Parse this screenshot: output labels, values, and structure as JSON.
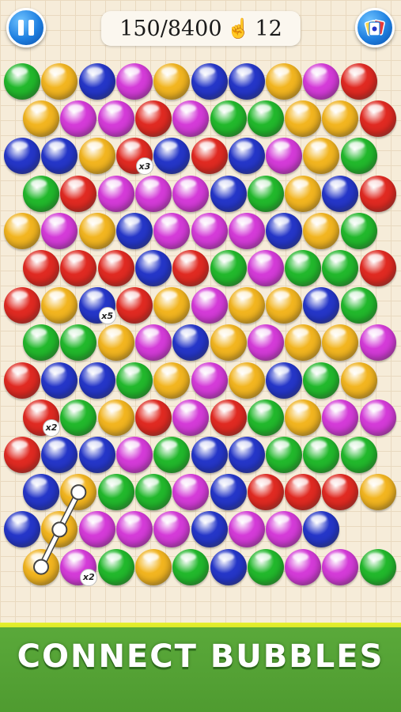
{
  "hud": {
    "score": "150/8400",
    "moves": "12",
    "pause_icon": "pause-icon",
    "cards_icon": "cards-icon",
    "hand_icon": "hand-pointer-icon"
  },
  "colors": {
    "G": "#22b82c",
    "Y": "#f2b520",
    "B": "#2536c8",
    "M": "#d43bd8",
    "R": "#e02a22"
  },
  "rows": [
    "GYBMYBBYMR",
    "YMMRMGGYYR",
    "BBYRBRBMYG",
    "GRMMMBGYBR",
    "YMYBMMMBYG",
    "RRRBRGMGGR",
    "RYBRYMYYBG",
    "GGYMBYMYYM",
    "RBBGYMYBGY",
    "RGYRMRGYMM",
    "RBBMGBBGGG",
    "BYGGMBRRRY",
    "BYMMMBMMB",
    "YMGYGBGMMG"
  ],
  "multipliers": [
    {
      "row": 2,
      "col": 3,
      "label": "x3"
    },
    {
      "row": 6,
      "col": 2,
      "label": "x5"
    },
    {
      "row": 9,
      "col": 0,
      "label": "x2"
    },
    {
      "row": 13,
      "col": 1,
      "label": "x2"
    }
  ],
  "connection_path": [
    [
      11,
      1
    ],
    [
      12,
      1
    ],
    [
      13,
      0
    ]
  ],
  "banner": {
    "title": "CONNECT BUBBLES"
  }
}
